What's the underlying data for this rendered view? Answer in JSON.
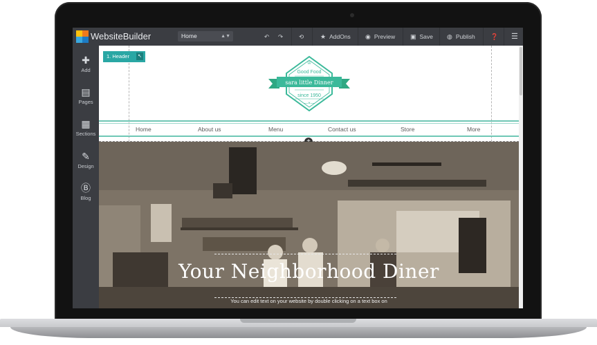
{
  "app": {
    "brand": "WebsiteBuilder"
  },
  "toolbar": {
    "page_select": "Home",
    "addons": "AddOns",
    "preview": "Preview",
    "save": "Save",
    "publish": "Publish"
  },
  "sidebar": {
    "items": [
      {
        "label": "Add",
        "icon": "plus-icon"
      },
      {
        "label": "Pages",
        "icon": "page-icon"
      },
      {
        "label": "Sections",
        "icon": "sections-icon"
      },
      {
        "label": "Design",
        "icon": "brush-icon"
      },
      {
        "label": "Blog",
        "icon": "blog-icon"
      }
    ]
  },
  "canvas": {
    "header_tag": "1. Header",
    "logo": {
      "top": "Good Food",
      "ribbon": "sara little Dinner",
      "since": "since 1950",
      "ornament": "—×—"
    },
    "nav": [
      "Home",
      "About us",
      "Menu",
      "Contact us",
      "Store",
      "More"
    ],
    "hero": {
      "title": "Your Neighborhood Diner",
      "subtitle": "You can edit text on your website by double clicking on a text box on"
    }
  },
  "colors": {
    "accent": "#2aa7a4",
    "toolbar": "#3b3d42",
    "nav_line": "#6fc7b5"
  }
}
